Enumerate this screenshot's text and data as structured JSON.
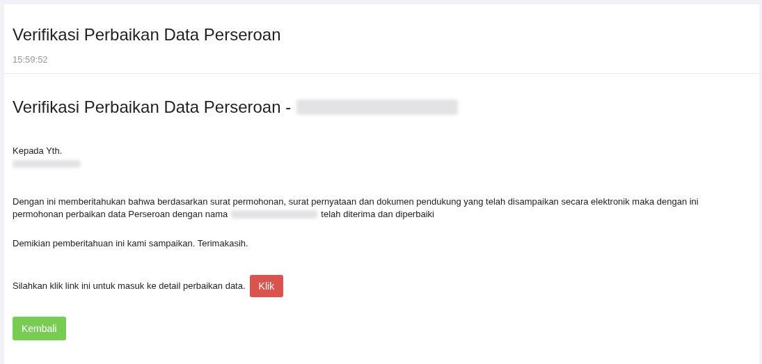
{
  "header": {
    "title": "Verifikasi Perbaikan Data Perseroan",
    "time": "15:59:52"
  },
  "content": {
    "heading": "Verifikasi Perbaikan Data Perseroan -",
    "heading_redacted": true,
    "salutation": "Kepada Yth.",
    "recipient_redacted": true,
    "paragraph_line_1": "Dengan ini memberitahukan bahwa berdasarkan surat permohonan, surat pernyataan dan dokumen pendukung yang telah disampaikan secara elektronik maka dengan ini",
    "paragraph_before": "permohonan perbaikan data Perseroan dengan nama",
    "paragraph_redacted": true,
    "paragraph_after": "telah diterima dan diperbaiki",
    "closing": "Demikian pemberitahuan ini kami sampaikan. Terimakasih.",
    "link_prompt": "Silahkan klik link ini untuk masuk ke detail perbaikan data.",
    "link_button": "Klik",
    "back_button": "Kembali"
  }
}
